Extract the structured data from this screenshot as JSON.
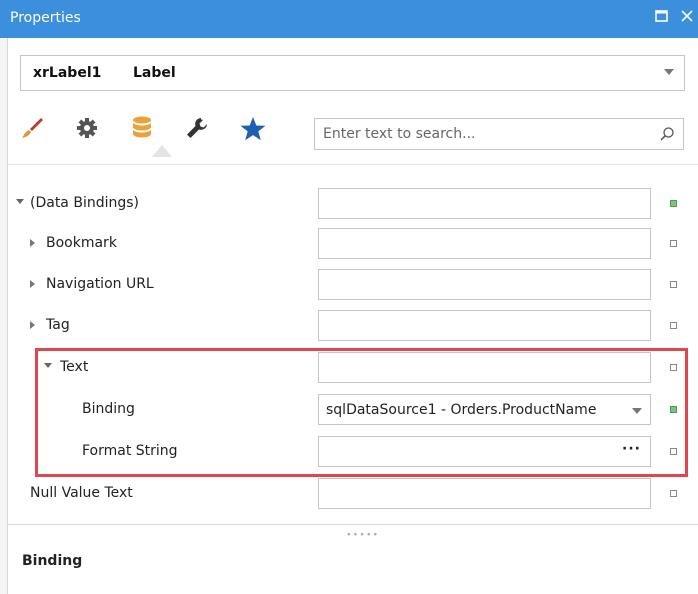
{
  "window": {
    "title": "Properties",
    "buttons": [
      "maximize-icon",
      "close-icon"
    ]
  },
  "object_selector": {
    "name": "xrLabel1",
    "type": "Label"
  },
  "toolbar": {
    "tabs": [
      {
        "icon": "brush-icon",
        "color": "#c0392b"
      },
      {
        "icon": "gear-icon",
        "color": "#555555"
      },
      {
        "icon": "database-icon",
        "color": "#e8a33a",
        "active": true
      },
      {
        "icon": "wrench-icon",
        "color": "#333333"
      },
      {
        "icon": "star-icon",
        "color": "#1e5fb4"
      }
    ],
    "search_placeholder": "Enter text to search..."
  },
  "properties": {
    "data_bindings": {
      "label": "(Data Bindings)",
      "value": "",
      "marker": "on"
    },
    "bookmark": {
      "label": "Bookmark",
      "value": "",
      "marker": "off"
    },
    "navigation_url": {
      "label": "Navigation URL",
      "value": "",
      "marker": "off"
    },
    "tag": {
      "label": "Tag",
      "value": "",
      "marker": "off"
    },
    "text": {
      "label": "Text",
      "value": "",
      "marker": "off"
    },
    "binding": {
      "label": "Binding",
      "value": "sqlDataSource1 - Orders.ProductName",
      "marker": "on"
    },
    "format_string": {
      "label": "Format String",
      "value": "",
      "ellipsis": "···",
      "marker": "off"
    },
    "null_value_text": {
      "label": "Null Value Text",
      "value": "",
      "marker": "off"
    }
  },
  "description": {
    "title": "Binding"
  },
  "colors": {
    "titlebar": "#3c8fdd",
    "highlight": "#e0474c",
    "marker_on": "#7cc47c"
  }
}
